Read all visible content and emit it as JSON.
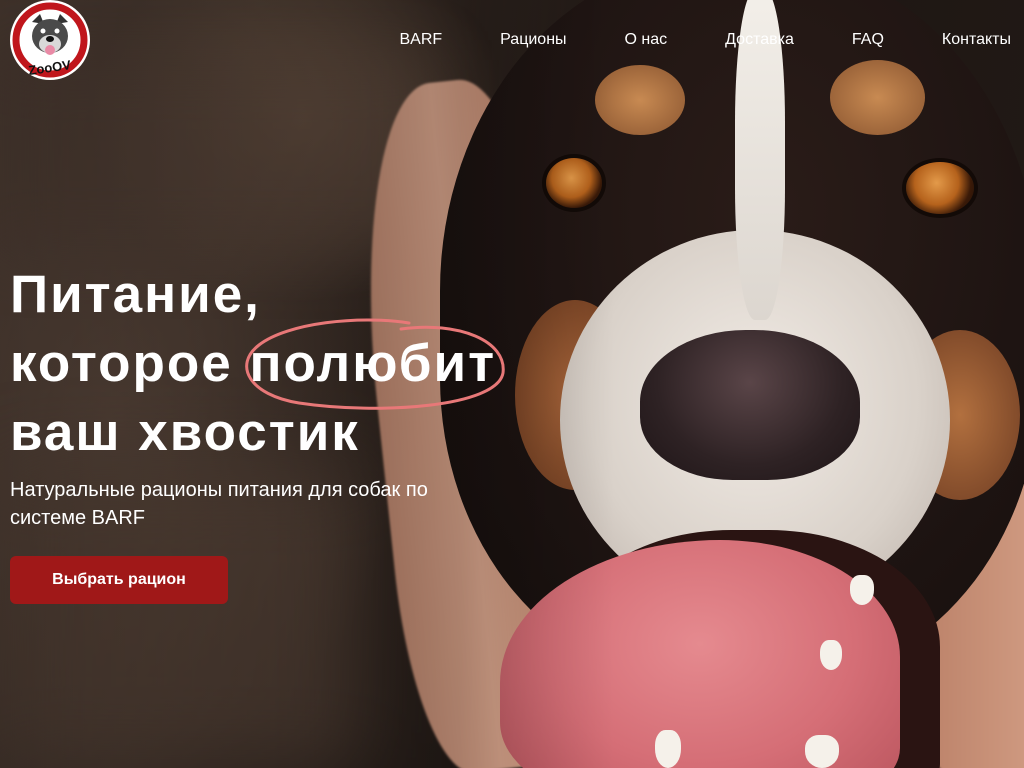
{
  "brand": {
    "logo_icon": "dog-face-logo-icon",
    "logo_text": "ZooOV",
    "colors": {
      "accent": "#a01818",
      "highlight": "#e87878"
    }
  },
  "nav": {
    "items": [
      {
        "label": "BARF"
      },
      {
        "label": "Рационы"
      },
      {
        "label": "О нас"
      },
      {
        "label": "Доставка"
      },
      {
        "label": "FAQ"
      },
      {
        "label": "Контакты"
      }
    ]
  },
  "hero": {
    "title_line1": "Питание,",
    "title_line2_prefix": "которое ",
    "title_highlight": "полюбит",
    "title_line3": "ваш хвостик",
    "subtitle": "Натуральные рационы питания для собак по системе BARF",
    "cta_label": "Выбрать рацион"
  }
}
